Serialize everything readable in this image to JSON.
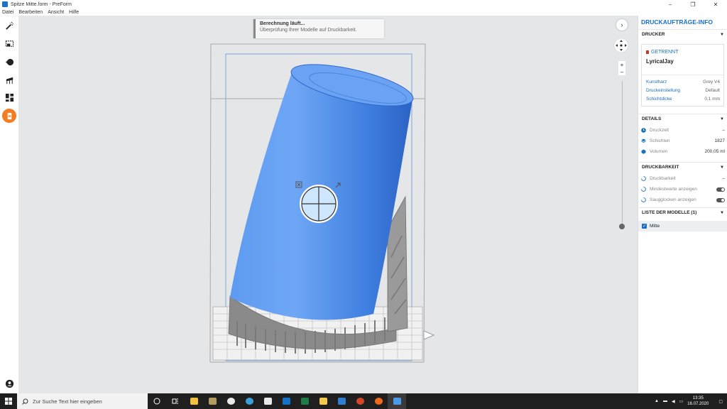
{
  "window": {
    "title": "Spitze Mitte.form - PreForm",
    "controls": [
      "–",
      "❐",
      "✕"
    ]
  },
  "menu": [
    "Datei",
    "Bearbeiten",
    "Ansicht",
    "Hilfe"
  ],
  "toolbar": {
    "tools": [
      "magic-wand",
      "select",
      "orientation",
      "supports",
      "layout",
      "print"
    ],
    "active_tool": "print"
  },
  "toast": {
    "title": "Berechnung läuft...",
    "message": "Überprüfung Ihrer Modelle auf Druckbarkeit."
  },
  "viewport": {
    "zoom_in": "+",
    "zoom_out": "–",
    "slider_level": 1.0
  },
  "panel": {
    "title": "DRUCKAUFTRÄGE-INFO",
    "printer_section": "DRUCKER",
    "printer": {
      "status": "GETRENNT",
      "name": "LyricalJay",
      "props": [
        {
          "key": "Kunstharz",
          "value": "Grey V4"
        },
        {
          "key": "Druckeinstellung",
          "value": "Default"
        },
        {
          "key": "Schichtdicke",
          "value": "0,1 mm"
        }
      ]
    },
    "details_section": "DETAILS",
    "details": [
      {
        "label": "Druckzeit",
        "value": "–"
      },
      {
        "label": "Schichten",
        "value": "1827"
      },
      {
        "label": "Volumen",
        "value": "200,05 ml"
      }
    ],
    "printability_section": "DRUCKBARKEIT",
    "printability": [
      {
        "label": "Druckbarkeit",
        "value": "–"
      },
      {
        "label": "Mindestwerte anzeigen"
      },
      {
        "label": "Saugglocken anzeigen"
      }
    ],
    "models_section": "LISTE DER MODELLE (1)",
    "models": [
      {
        "name": "Mitte",
        "checked": true
      }
    ]
  },
  "taskbar": {
    "search_placeholder": "Zur Suche Text hier eingeben",
    "apps": [
      "task-view",
      "file-explorer",
      "media-player",
      "itunes",
      "edge",
      "outlook",
      "excel",
      "notes",
      "photos",
      "powerpoint",
      "firefox",
      "preform"
    ],
    "time": "13:35",
    "date": "16.07.2020"
  },
  "colors": {
    "accent": "#1a6fc4",
    "active_tool": "#f57c1f",
    "model": "#3b7be0",
    "support": "#8a8a8a",
    "viewport": "#e4e6e8"
  }
}
